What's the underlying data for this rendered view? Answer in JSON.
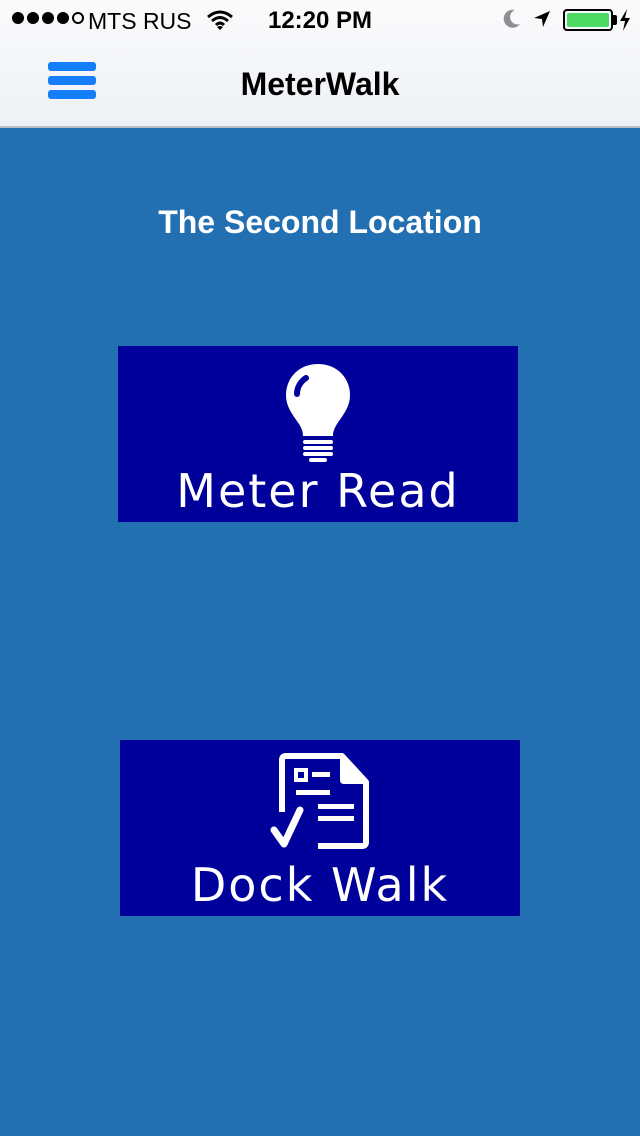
{
  "status_bar": {
    "carrier": "MTS RUS",
    "time": "12:20 PM",
    "signal_bars_filled": 4,
    "signal_bars_total": 5,
    "battery_level": 1.0,
    "battery_color": "#4cd964"
  },
  "nav_bar": {
    "title": "MeterWalk",
    "menu_icon": "hamburger-menu-icon",
    "accent_color": "#157efb"
  },
  "main": {
    "location_title": "The Second Location",
    "background_color": "#226fb2",
    "tiles": [
      {
        "label": "Meter Read",
        "icon": "lightbulb-icon",
        "color": "#00009b"
      },
      {
        "label": "Dock Walk",
        "icon": "checklist-document-icon",
        "color": "#00009b"
      }
    ]
  }
}
